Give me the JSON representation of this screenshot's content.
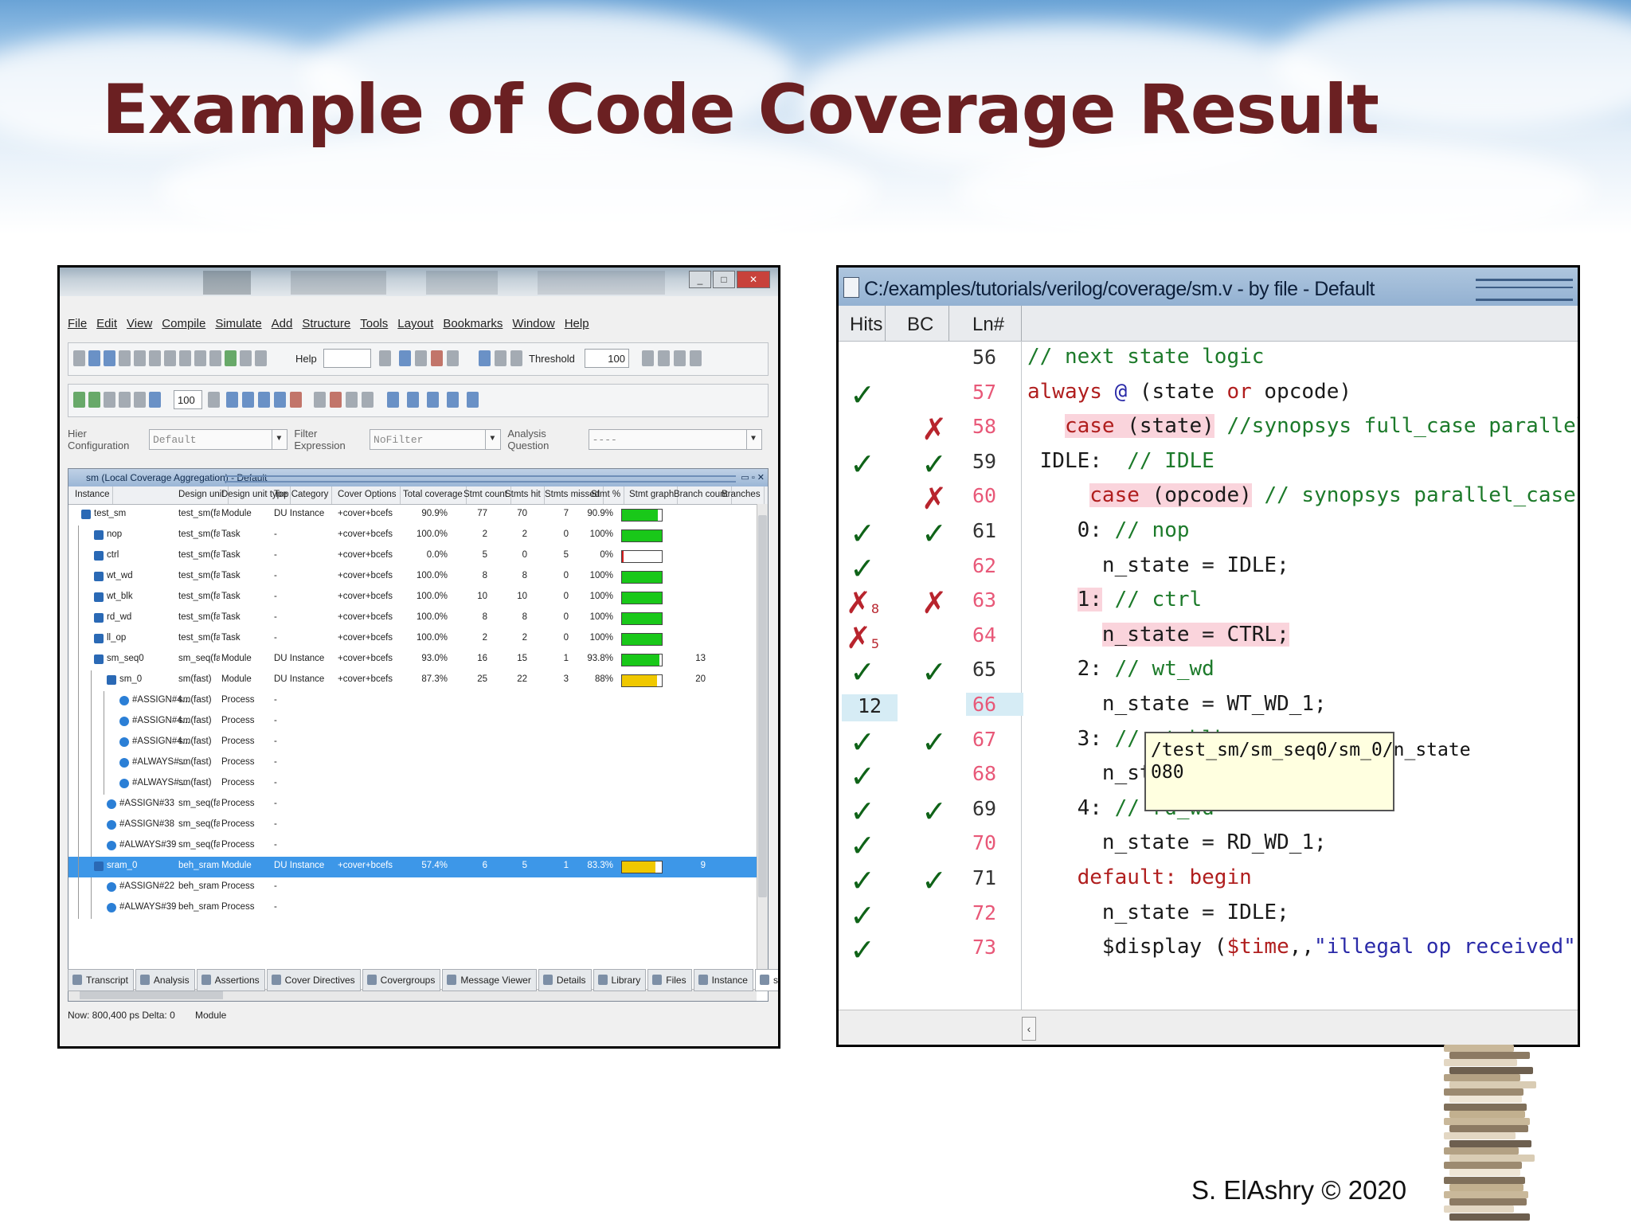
{
  "slide": {
    "title": "Example of Code Coverage Result",
    "footer": "S. ElAshry © 2020"
  },
  "left_window": {
    "menu": [
      "File",
      "Edit",
      "View",
      "Compile",
      "Simulate",
      "Add",
      "Structure",
      "Tools",
      "Layout",
      "Bookmarks",
      "Window",
      "Help"
    ],
    "toolbar": {
      "help_label": "Help",
      "threshold_label": "Threshold",
      "threshold_value": "100",
      "zoom_value": "100"
    },
    "config": {
      "hier_label": "Hier Configuration",
      "hier_value": "Default",
      "filter_label": "Filter Expression",
      "filter_value": "NoFilter",
      "analysis_label": "Analysis Question",
      "analysis_value": "----"
    },
    "coverage_panel_title": "sm (Local Coverage Aggregation) - Default",
    "columns": [
      "Instance",
      "Design unit",
      "Design unit type",
      "Top Category",
      "Cover Options",
      "Total coverage",
      "Stmt count",
      "Stmts hit",
      "Stmts missed",
      "Stmt %",
      "Stmt graph",
      "Branch count",
      "Branches"
    ],
    "rows": [
      {
        "instance": "test_sm",
        "du": "test_sm(fast)",
        "type": "Module",
        "top": "DU Instance",
        "opts": "+cover+bcefs",
        "total": "90.9%",
        "count": "77",
        "hit": "70",
        "missed": "7",
        "pct": "90.9%",
        "fill": 0.909,
        "bar": "#19c819",
        "branch": "",
        "depth": 0,
        "kind": "module"
      },
      {
        "instance": "nop",
        "du": "test_sm(fast)",
        "type": "Task",
        "top": "-",
        "opts": "+cover+bcefs",
        "total": "100.0%",
        "count": "2",
        "hit": "2",
        "missed": "0",
        "pct": "100%",
        "fill": 1.0,
        "bar": "#19c819",
        "branch": "",
        "depth": 1,
        "kind": "module"
      },
      {
        "instance": "ctrl",
        "du": "test_sm(fast)",
        "type": "Task",
        "top": "-",
        "opts": "+cover+bcefs",
        "total": "0.0%",
        "count": "5",
        "hit": "0",
        "missed": "5",
        "pct": "0%",
        "fill": 0.0,
        "bar": "#d42020",
        "branch": "",
        "depth": 1,
        "kind": "module"
      },
      {
        "instance": "wt_wd",
        "du": "test_sm(fast)",
        "type": "Task",
        "top": "-",
        "opts": "+cover+bcefs",
        "total": "100.0%",
        "count": "8",
        "hit": "8",
        "missed": "0",
        "pct": "100%",
        "fill": 1.0,
        "bar": "#19c819",
        "branch": "",
        "depth": 1,
        "kind": "module"
      },
      {
        "instance": "wt_blk",
        "du": "test_sm(fast)",
        "type": "Task",
        "top": "-",
        "opts": "+cover+bcefs",
        "total": "100.0%",
        "count": "10",
        "hit": "10",
        "missed": "0",
        "pct": "100%",
        "fill": 1.0,
        "bar": "#19c819",
        "branch": "",
        "depth": 1,
        "kind": "module"
      },
      {
        "instance": "rd_wd",
        "du": "test_sm(fast)",
        "type": "Task",
        "top": "-",
        "opts": "+cover+bcefs",
        "total": "100.0%",
        "count": "8",
        "hit": "8",
        "missed": "0",
        "pct": "100%",
        "fill": 1.0,
        "bar": "#19c819",
        "branch": "",
        "depth": 1,
        "kind": "module"
      },
      {
        "instance": "ll_op",
        "du": "test_sm(fast)",
        "type": "Task",
        "top": "-",
        "opts": "+cover+bcefs",
        "total": "100.0%",
        "count": "2",
        "hit": "2",
        "missed": "0",
        "pct": "100%",
        "fill": 1.0,
        "bar": "#19c819",
        "branch": "",
        "depth": 1,
        "kind": "module"
      },
      {
        "instance": "sm_seq0",
        "du": "sm_seq(fast)",
        "type": "Module",
        "top": "DU Instance",
        "opts": "+cover+bcefs",
        "total": "93.0%",
        "count": "16",
        "hit": "15",
        "missed": "1",
        "pct": "93.8%",
        "fill": 0.938,
        "bar": "#19c819",
        "branch": "13",
        "depth": 1,
        "kind": "module"
      },
      {
        "instance": "sm_0",
        "du": "sm(fast)",
        "type": "Module",
        "top": "DU Instance",
        "opts": "+cover+bcefs",
        "total": "87.3%",
        "count": "25",
        "hit": "22",
        "missed": "3",
        "pct": "88%",
        "fill": 0.88,
        "bar": "#f0c800",
        "branch": "20",
        "depth": 2,
        "kind": "module"
      },
      {
        "instance": "#ASSIGN#4...",
        "du": "sm(fast)",
        "type": "Process",
        "top": "-",
        "opts": "",
        "total": "",
        "count": "",
        "hit": "",
        "missed": "",
        "pct": "",
        "fill": null,
        "bar": "",
        "branch": "",
        "depth": 3,
        "kind": "proc"
      },
      {
        "instance": "#ASSIGN#4...",
        "du": "sm(fast)",
        "type": "Process",
        "top": "-",
        "opts": "",
        "total": "",
        "count": "",
        "hit": "",
        "missed": "",
        "pct": "",
        "fill": null,
        "bar": "",
        "branch": "",
        "depth": 3,
        "kind": "proc"
      },
      {
        "instance": "#ASSIGN#4...",
        "du": "sm(fast)",
        "type": "Process",
        "top": "-",
        "opts": "",
        "total": "",
        "count": "",
        "hit": "",
        "missed": "",
        "pct": "",
        "fill": null,
        "bar": "",
        "branch": "",
        "depth": 3,
        "kind": "proc"
      },
      {
        "instance": "#ALWAYS#...",
        "du": "sm(fast)",
        "type": "Process",
        "top": "-",
        "opts": "",
        "total": "",
        "count": "",
        "hit": "",
        "missed": "",
        "pct": "",
        "fill": null,
        "bar": "",
        "branch": "",
        "depth": 3,
        "kind": "proc"
      },
      {
        "instance": "#ALWAYS#...",
        "du": "sm(fast)",
        "type": "Process",
        "top": "-",
        "opts": "",
        "total": "",
        "count": "",
        "hit": "",
        "missed": "",
        "pct": "",
        "fill": null,
        "bar": "",
        "branch": "",
        "depth": 3,
        "kind": "proc"
      },
      {
        "instance": "#ASSIGN#33",
        "du": "sm_seq(fast)",
        "type": "Process",
        "top": "-",
        "opts": "",
        "total": "",
        "count": "",
        "hit": "",
        "missed": "",
        "pct": "",
        "fill": null,
        "bar": "",
        "branch": "",
        "depth": 2,
        "kind": "proc"
      },
      {
        "instance": "#ASSIGN#38",
        "du": "sm_seq(fast)",
        "type": "Process",
        "top": "-",
        "opts": "",
        "total": "",
        "count": "",
        "hit": "",
        "missed": "",
        "pct": "",
        "fill": null,
        "bar": "",
        "branch": "",
        "depth": 2,
        "kind": "proc"
      },
      {
        "instance": "#ALWAYS#39",
        "du": "sm_seq(fast)",
        "type": "Process",
        "top": "-",
        "opts": "",
        "total": "",
        "count": "",
        "hit": "",
        "missed": "",
        "pct": "",
        "fill": null,
        "bar": "",
        "branch": "",
        "depth": 2,
        "kind": "proc"
      },
      {
        "instance": "sram_0",
        "du": "beh_sram(f...",
        "type": "Module",
        "top": "DU Instance",
        "opts": "+cover+bcefs",
        "total": "57.4%",
        "count": "6",
        "hit": "5",
        "missed": "1",
        "pct": "83.3%",
        "fill": 0.833,
        "bar": "#f0c800",
        "branch": "9",
        "depth": 1,
        "kind": "module",
        "selected": true
      },
      {
        "instance": "#ASSIGN#22",
        "du": "beh_sram(f...",
        "type": "Process",
        "top": "-",
        "opts": "",
        "total": "",
        "count": "",
        "hit": "",
        "missed": "",
        "pct": "",
        "fill": null,
        "bar": "",
        "branch": "",
        "depth": 2,
        "kind": "proc"
      },
      {
        "instance": "#ALWAYS#39",
        "du": "beh_sram(f...",
        "type": "Process",
        "top": "-",
        "opts": "",
        "total": "",
        "count": "",
        "hit": "",
        "missed": "",
        "pct": "",
        "fill": null,
        "bar": "",
        "branch": "",
        "depth": 2,
        "kind": "proc"
      }
    ],
    "tabs": [
      "Transcript",
      "Analysis",
      "Assertions",
      "Cover Directives",
      "Covergroups",
      "Message Viewer",
      "Details",
      "Library",
      "Files",
      "Instance",
      "sm"
    ],
    "status": {
      "now": "Now: 800,400 ps  Delta: 0",
      "context": "Module"
    }
  },
  "right_window": {
    "title": "C:/examples/tutorials/verilog/coverage/sm.v - by file - Default",
    "headers": {
      "hits": "Hits",
      "bc": "BC",
      "ln": "Ln#"
    },
    "lines": [
      {
        "ln": "56",
        "hits": "",
        "bc": "",
        "miss": false,
        "parts": [
          {
            "t": "// next state logic",
            "c": "comment"
          }
        ]
      },
      {
        "ln": "57",
        "hits": "check",
        "bc": "",
        "miss": true,
        "parts": [
          {
            "t": "always",
            "c": "kw"
          },
          {
            "t": " @ ",
            "c": "kwb"
          },
          {
            "t": "(state ",
            "c": ""
          },
          {
            "t": "or",
            "c": "kw"
          },
          {
            "t": " opcode)",
            "c": ""
          }
        ]
      },
      {
        "ln": "58",
        "hits": "",
        "bc": "x",
        "miss": true,
        "parts": [
          {
            "t": "   ",
            "c": ""
          },
          {
            "t": "case",
            "c": "kw missbg"
          },
          {
            "t": " (state)",
            "c": "missbg"
          },
          {
            "t": " //synopsys full_case parallel_case",
            "c": "comment"
          }
        ]
      },
      {
        "ln": "59",
        "hits": "check",
        "bc": "check",
        "miss": false,
        "parts": [
          {
            "t": " IDLE:  ",
            "c": ""
          },
          {
            "t": "// IDLE",
            "c": "comment"
          }
        ]
      },
      {
        "ln": "60",
        "hits": "",
        "bc": "x",
        "miss": true,
        "parts": [
          {
            "t": "     ",
            "c": ""
          },
          {
            "t": "case",
            "c": "kw missbg"
          },
          {
            "t": " (opcode)",
            "c": "missbg"
          },
          {
            "t": " // synopsys parallel_case",
            "c": "comment"
          }
        ]
      },
      {
        "ln": "61",
        "hits": "check",
        "bc": "check",
        "miss": false,
        "parts": [
          {
            "t": "    0: ",
            "c": ""
          },
          {
            "t": "// nop",
            "c": "comment"
          }
        ]
      },
      {
        "ln": "62",
        "hits": "check",
        "bc": "",
        "miss": true,
        "parts": [
          {
            "t": "      n_state = IDLE;",
            "c": ""
          }
        ]
      },
      {
        "ln": "63",
        "hits": "x8",
        "bc": "x",
        "miss": true,
        "parts": [
          {
            "t": "    ",
            "c": ""
          },
          {
            "t": "1:",
            "c": "missbg"
          },
          {
            "t": " // ctrl",
            "c": "comment"
          }
        ]
      },
      {
        "ln": "64",
        "hits": "x5",
        "bc": "",
        "miss": true,
        "parts": [
          {
            "t": "      ",
            "c": ""
          },
          {
            "t": "n_state = CTRL;",
            "c": "missbg"
          }
        ]
      },
      {
        "ln": "65",
        "hits": "check",
        "bc": "check",
        "miss": false,
        "parts": [
          {
            "t": "    2: ",
            "c": ""
          },
          {
            "t": "// wt_wd",
            "c": "comment"
          }
        ]
      },
      {
        "ln": "66",
        "hits": "12",
        "bc": "",
        "miss": true,
        "hl": true,
        "parts": [
          {
            "t": "      n_state = WT_WD_1;",
            "c": ""
          }
        ]
      },
      {
        "ln": "67",
        "hits": "check",
        "bc": "check",
        "miss": true,
        "parts": [
          {
            "t": "    3: ",
            "c": ""
          },
          {
            "t": "// wt_blk",
            "c": "comment"
          }
        ]
      },
      {
        "ln": "68",
        "hits": "check",
        "bc": "",
        "miss": true,
        "parts": [
          {
            "t": "      n_state = WT_BLK_1;",
            "c": ""
          }
        ]
      },
      {
        "ln": "69",
        "hits": "check",
        "bc": "check",
        "miss": false,
        "parts": [
          {
            "t": "    4: ",
            "c": ""
          },
          {
            "t": "// rd_wd",
            "c": "comment"
          }
        ]
      },
      {
        "ln": "70",
        "hits": "check",
        "bc": "",
        "miss": true,
        "parts": [
          {
            "t": "      n_state = RD_WD_1;",
            "c": ""
          }
        ]
      },
      {
        "ln": "71",
        "hits": "check",
        "bc": "check",
        "miss": false,
        "parts": [
          {
            "t": "    ",
            "c": ""
          },
          {
            "t": "default: begin",
            "c": "kw"
          }
        ]
      },
      {
        "ln": "72",
        "hits": "check",
        "bc": "",
        "miss": true,
        "parts": [
          {
            "t": "      n_state = IDLE;",
            "c": ""
          }
        ]
      },
      {
        "ln": "73",
        "hits": "check",
        "bc": "",
        "miss": true,
        "parts": [
          {
            "t": "      $display (",
            "c": ""
          },
          {
            "t": "$time",
            "c": "kw"
          },
          {
            "t": ",,",
            "c": ""
          },
          {
            "t": "\"illegal op received\"",
            "c": "str"
          },
          {
            "t": ");",
            "c": ""
          }
        ]
      }
    ],
    "tooltip": {
      "path": "/test_sm/sm_seq0/sm_0/n_state",
      "value": "080"
    }
  }
}
